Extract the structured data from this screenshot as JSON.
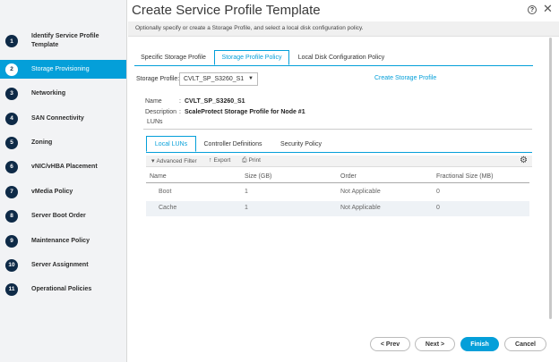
{
  "window": {
    "title": "Create Service Profile Template",
    "subtitle": "Optionally specify or create a Storage Profile, and select a local disk configuration policy.",
    "help_glyph": "?",
    "close_glyph": "✕"
  },
  "sidebar": {
    "active_index": 1,
    "steps": [
      {
        "num": "1",
        "label": "Identify Service Profile Template"
      },
      {
        "num": "2",
        "label": "Storage Provisioning"
      },
      {
        "num": "3",
        "label": "Networking"
      },
      {
        "num": "4",
        "label": "SAN Connectivity"
      },
      {
        "num": "5",
        "label": "Zoning"
      },
      {
        "num": "6",
        "label": "vNIC/vHBA Placement"
      },
      {
        "num": "7",
        "label": "vMedia Policy"
      },
      {
        "num": "8",
        "label": "Server Boot Order"
      },
      {
        "num": "9",
        "label": "Maintenance Policy"
      },
      {
        "num": "10",
        "label": "Server Assignment"
      },
      {
        "num": "11",
        "label": "Operational Policies"
      }
    ]
  },
  "top_tabs": {
    "specific": "Specific Storage Profile",
    "policy": "Storage Profile Policy",
    "local_disk": "Local Disk Configuration Policy",
    "active": "policy"
  },
  "storage_profile": {
    "label": "Storage Profile:",
    "value": "CVLT_SP_S3260_S1",
    "caret": "▼",
    "create_link": "Create Storage Profile"
  },
  "details": {
    "name_label": "Name",
    "name_sep": ":",
    "name_value": "CVLT_SP_S3260_S1",
    "description_label": "Description",
    "description_sep": ":",
    "description_value": "ScaleProtect Storage Profile for Node #1",
    "luns_label": "LUNs"
  },
  "inner_tabs": {
    "local_luns": "Local LUNs",
    "controller": "Controller Definitions",
    "security": "Security Policy",
    "active": "local_luns"
  },
  "toolbar": {
    "filter_icon": "▾",
    "filter": "Advanced Filter",
    "export_icon": "↑",
    "export": "Export",
    "print_icon": "⎙",
    "print": "Print",
    "settings_glyph": "⚙"
  },
  "table": {
    "columns": [
      "Name",
      "Size (GB)",
      "Order",
      "Fractional Size (MB)"
    ],
    "rows": [
      [
        "Boot",
        "1",
        "Not Applicable",
        "0"
      ],
      [
        "Cache",
        "1",
        "Not Applicable",
        "0"
      ]
    ]
  },
  "footer": {
    "prev": "< Prev",
    "next": "Next >",
    "finish": "Finish",
    "cancel": "Cancel"
  },
  "colors": {
    "accent": "#049fd9",
    "step_circle": "#0e2a47"
  }
}
